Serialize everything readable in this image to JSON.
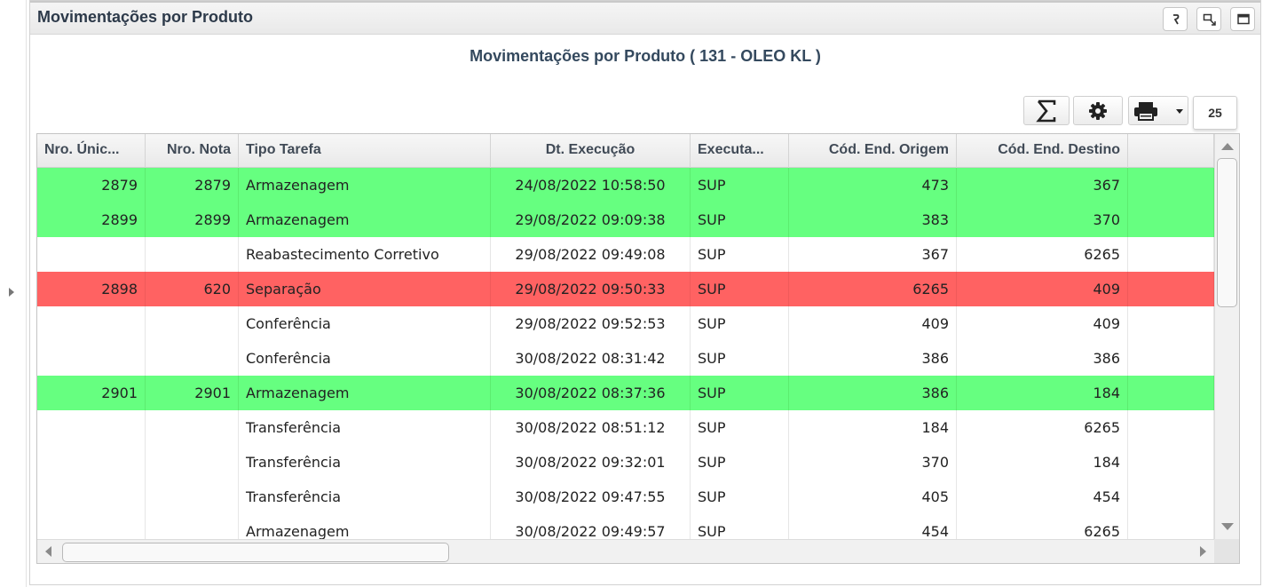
{
  "panel": {
    "title": "Movimentações por Produto",
    "header_buttons": [
      {
        "name": "undo-icon"
      },
      {
        "name": "restore-icon"
      },
      {
        "name": "maximize-icon"
      }
    ]
  },
  "report": {
    "title": "Movimentações por Produto ( 131 - OLEO KL )"
  },
  "toolbar": {
    "sum_icon": "sigma-icon",
    "settings_icon": "gear-icon",
    "print_icon": "printer-icon",
    "dropdown_icon": "caret-down-icon",
    "page_size": "25"
  },
  "colors": {
    "green_row": "#66ff80",
    "red_row": "#ff6262",
    "white_row": "#ffffff"
  },
  "table": {
    "columns": [
      {
        "label": "Nro. Únic...",
        "align": "left"
      },
      {
        "label": "Nro. Nota",
        "align": "right"
      },
      {
        "label": "Tipo Tarefa",
        "align": "left"
      },
      {
        "label": "Dt. Execução",
        "align": "center"
      },
      {
        "label": "Executa...",
        "align": "left"
      },
      {
        "label": "Cód. End. Origem",
        "align": "right"
      },
      {
        "label": "Cód. End. Destino",
        "align": "right"
      },
      {
        "label": "",
        "align": "left"
      }
    ],
    "rows": [
      {
        "status": "green",
        "cells": [
          "2879",
          "2879",
          "Armazenagem",
          "24/08/2022 10:58:50",
          "SUP",
          "473",
          "367"
        ]
      },
      {
        "status": "green",
        "cells": [
          "2899",
          "2899",
          "Armazenagem",
          "29/08/2022 09:09:38",
          "SUP",
          "383",
          "370"
        ]
      },
      {
        "status": "white",
        "cells": [
          "",
          "",
          "Reabastecimento Corretivo",
          "29/08/2022 09:49:08",
          "SUP",
          "367",
          "6265"
        ]
      },
      {
        "status": "red",
        "cells": [
          "2898",
          "620",
          "Separação",
          "29/08/2022 09:50:33",
          "SUP",
          "6265",
          "409"
        ]
      },
      {
        "status": "white",
        "cells": [
          "",
          "",
          "Conferência",
          "29/08/2022 09:52:53",
          "SUP",
          "409",
          "409"
        ]
      },
      {
        "status": "white",
        "cells": [
          "",
          "",
          "Conferência",
          "30/08/2022 08:31:42",
          "SUP",
          "386",
          "386"
        ]
      },
      {
        "status": "green",
        "cells": [
          "2901",
          "2901",
          "Armazenagem",
          "30/08/2022 08:37:36",
          "SUP",
          "386",
          "184"
        ]
      },
      {
        "status": "white",
        "cells": [
          "",
          "",
          "Transferência",
          "30/08/2022 08:51:12",
          "SUP",
          "184",
          "6265"
        ]
      },
      {
        "status": "white",
        "cells": [
          "",
          "",
          "Transferência",
          "30/08/2022 09:32:01",
          "SUP",
          "370",
          "184"
        ]
      },
      {
        "status": "white",
        "cells": [
          "",
          "",
          "Transferência",
          "30/08/2022 09:47:55",
          "SUP",
          "405",
          "454"
        ]
      },
      {
        "status": "white",
        "cells": [
          "",
          "",
          "Armazenagem",
          "30/08/2022 09:49:57",
          "SUP",
          "454",
          "6265"
        ]
      }
    ]
  }
}
